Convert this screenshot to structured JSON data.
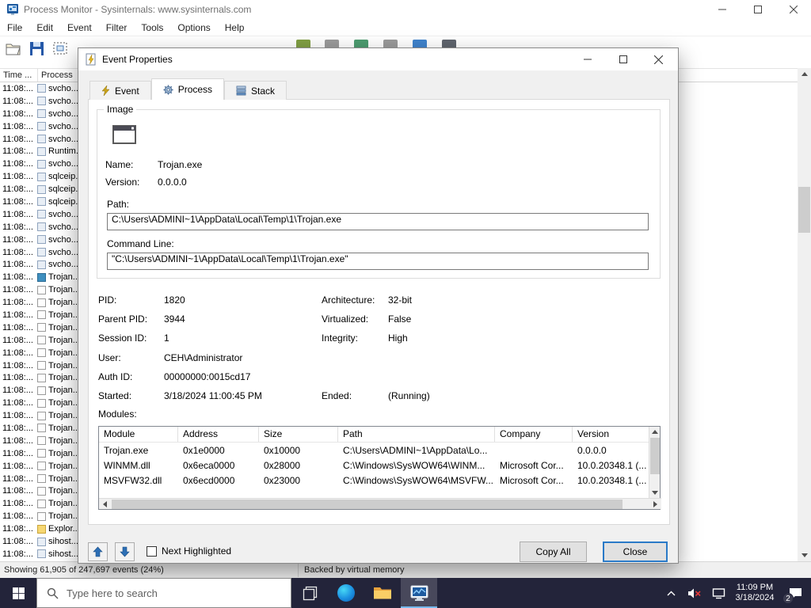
{
  "main_window": {
    "title": "Process Monitor - Sysinternals: www.sysinternals.com",
    "menu_items": [
      {
        "label": "File"
      },
      {
        "label": "Edit"
      },
      {
        "label": "Event"
      },
      {
        "label": "Filter"
      },
      {
        "label": "Tools"
      },
      {
        "label": "Options"
      },
      {
        "label": "Help"
      }
    ],
    "header": {
      "time_col": "Time ...",
      "process_col": "Process"
    },
    "rows": [
      {
        "time": "11:08:...",
        "process": "svcho...",
        "icon": "proc"
      },
      {
        "time": "11:08:...",
        "process": "svcho...",
        "icon": "proc"
      },
      {
        "time": "11:08:...",
        "process": "svcho...",
        "icon": "proc"
      },
      {
        "time": "11:08:...",
        "process": "svcho...",
        "icon": "proc"
      },
      {
        "time": "11:08:...",
        "process": "svcho...",
        "icon": "proc"
      },
      {
        "time": "11:08:...",
        "process": "Runtim...",
        "icon": "proc"
      },
      {
        "time": "11:08:...",
        "process": "svcho...",
        "icon": "proc"
      },
      {
        "time": "11:08:...",
        "process": "sqlceip...",
        "icon": "proc"
      },
      {
        "time": "11:08:...",
        "process": "sqlceip...",
        "icon": "proc"
      },
      {
        "time": "11:08:...",
        "process": "sqlceip...",
        "icon": "proc"
      },
      {
        "time": "11:08:...",
        "process": "svcho...",
        "icon": "proc"
      },
      {
        "time": "11:08:...",
        "process": "svcho...",
        "icon": "proc"
      },
      {
        "time": "11:08:...",
        "process": "svcho...",
        "icon": "proc"
      },
      {
        "time": "11:08:...",
        "process": "svcho...",
        "icon": "proc"
      },
      {
        "time": "11:08:...",
        "process": "svcho...",
        "icon": "proc"
      },
      {
        "time": "11:08:...",
        "process": "Trojan...",
        "icon": "sel"
      },
      {
        "time": "11:08:...",
        "process": "Trojan...",
        "icon": "doc"
      },
      {
        "time": "11:08:...",
        "process": "Trojan...",
        "icon": "doc"
      },
      {
        "time": "11:08:...",
        "process": "Trojan...",
        "icon": "doc"
      },
      {
        "time": "11:08:...",
        "process": "Trojan...",
        "icon": "doc"
      },
      {
        "time": "11:08:...",
        "process": "Trojan...",
        "icon": "doc"
      },
      {
        "time": "11:08:...",
        "process": "Trojan...",
        "icon": "doc"
      },
      {
        "time": "11:08:...",
        "process": "Trojan...",
        "icon": "doc"
      },
      {
        "time": "11:08:...",
        "process": "Trojan...",
        "icon": "doc"
      },
      {
        "time": "11:08:...",
        "process": "Trojan...",
        "icon": "doc"
      },
      {
        "time": "11:08:...",
        "process": "Trojan...",
        "icon": "doc"
      },
      {
        "time": "11:08:...",
        "process": "Trojan...",
        "icon": "doc"
      },
      {
        "time": "11:08:...",
        "process": "Trojan...",
        "icon": "doc"
      },
      {
        "time": "11:08:...",
        "process": "Trojan...",
        "icon": "doc"
      },
      {
        "time": "11:08:...",
        "process": "Trojan...",
        "icon": "doc"
      },
      {
        "time": "11:08:...",
        "process": "Trojan...",
        "icon": "doc"
      },
      {
        "time": "11:08:...",
        "process": "Trojan...",
        "icon": "doc"
      },
      {
        "time": "11:08:...",
        "process": "Trojan...",
        "icon": "doc"
      },
      {
        "time": "11:08:...",
        "process": "Trojan...",
        "icon": "doc"
      },
      {
        "time": "11:08:...",
        "process": "Trojan...",
        "icon": "doc"
      },
      {
        "time": "11:08:...",
        "process": "Explor...",
        "icon": "folder"
      },
      {
        "time": "11:08:...",
        "process": "sihost...",
        "icon": "proc"
      },
      {
        "time": "11:08:...",
        "process": "sihost...",
        "icon": "proc"
      }
    ],
    "status": {
      "left": "Showing 61,905 of 247,697 events (24%)",
      "right": "Backed by virtual memory"
    }
  },
  "dialog": {
    "title": "Event Properties",
    "tabs": {
      "event": "Event",
      "process": "Process",
      "stack": "Stack"
    },
    "image": {
      "group_label": "Image",
      "name_label": "Name:",
      "name": "Trojan.exe",
      "version_label": "Version:",
      "version": "0.0.0.0",
      "path_label": "Path:",
      "path": "C:\\Users\\ADMINI~1\\AppData\\Local\\Temp\\1\\Trojan.exe",
      "cmdline_label": "Command Line:",
      "cmdline": "\"C:\\Users\\ADMINI~1\\AppData\\Local\\Temp\\1\\Trojan.exe\""
    },
    "details": {
      "pid_label": "PID:",
      "pid": "1820",
      "arch_label": "Architecture:",
      "arch": "32-bit",
      "ppid_label": "Parent PID:",
      "ppid": "3944",
      "virt_label": "Virtualized:",
      "virt": "False",
      "session_label": "Session ID:",
      "session": "1",
      "integrity_label": "Integrity:",
      "integrity": "High",
      "user_label": "User:",
      "user": "CEH\\Administrator",
      "auth_label": "Auth ID:",
      "auth": "00000000:0015cd17",
      "started_label": "Started:",
      "started": "3/18/2024 11:00:45 PM",
      "ended_label": "Ended:",
      "ended": "(Running)"
    },
    "modules_label": "Modules:",
    "modules": {
      "columns": [
        "Module",
        "Address",
        "Size",
        "Path",
        "Company",
        "Version"
      ],
      "rows": [
        {
          "module": "Trojan.exe",
          "address": "0x1e0000",
          "size": "0x10000",
          "path": "C:\\Users\\ADMINI~1\\AppData\\Lo...",
          "company": "",
          "version": "0.0.0.0"
        },
        {
          "module": "WINMM.dll",
          "address": "0x6eca0000",
          "size": "0x28000",
          "path": "C:\\Windows\\SysWOW64\\WINM...",
          "company": "Microsoft Cor...",
          "version": "10.0.20348.1 (..."
        },
        {
          "module": "MSVFW32.dll",
          "address": "0x6ecd0000",
          "size": "0x23000",
          "path": "C:\\Windows\\SysWOW64\\MSVFW...",
          "company": "Microsoft Cor...",
          "version": "10.0.20348.1 (..."
        }
      ]
    },
    "footer": {
      "next_highlighted": "Next Highlighted",
      "copy_all": "Copy All",
      "close": "Close"
    }
  },
  "taskbar": {
    "search_placeholder": "Type here to search",
    "clock": {
      "time": "11:09 PM",
      "date": "3/18/2024"
    },
    "notification_count": "2"
  }
}
